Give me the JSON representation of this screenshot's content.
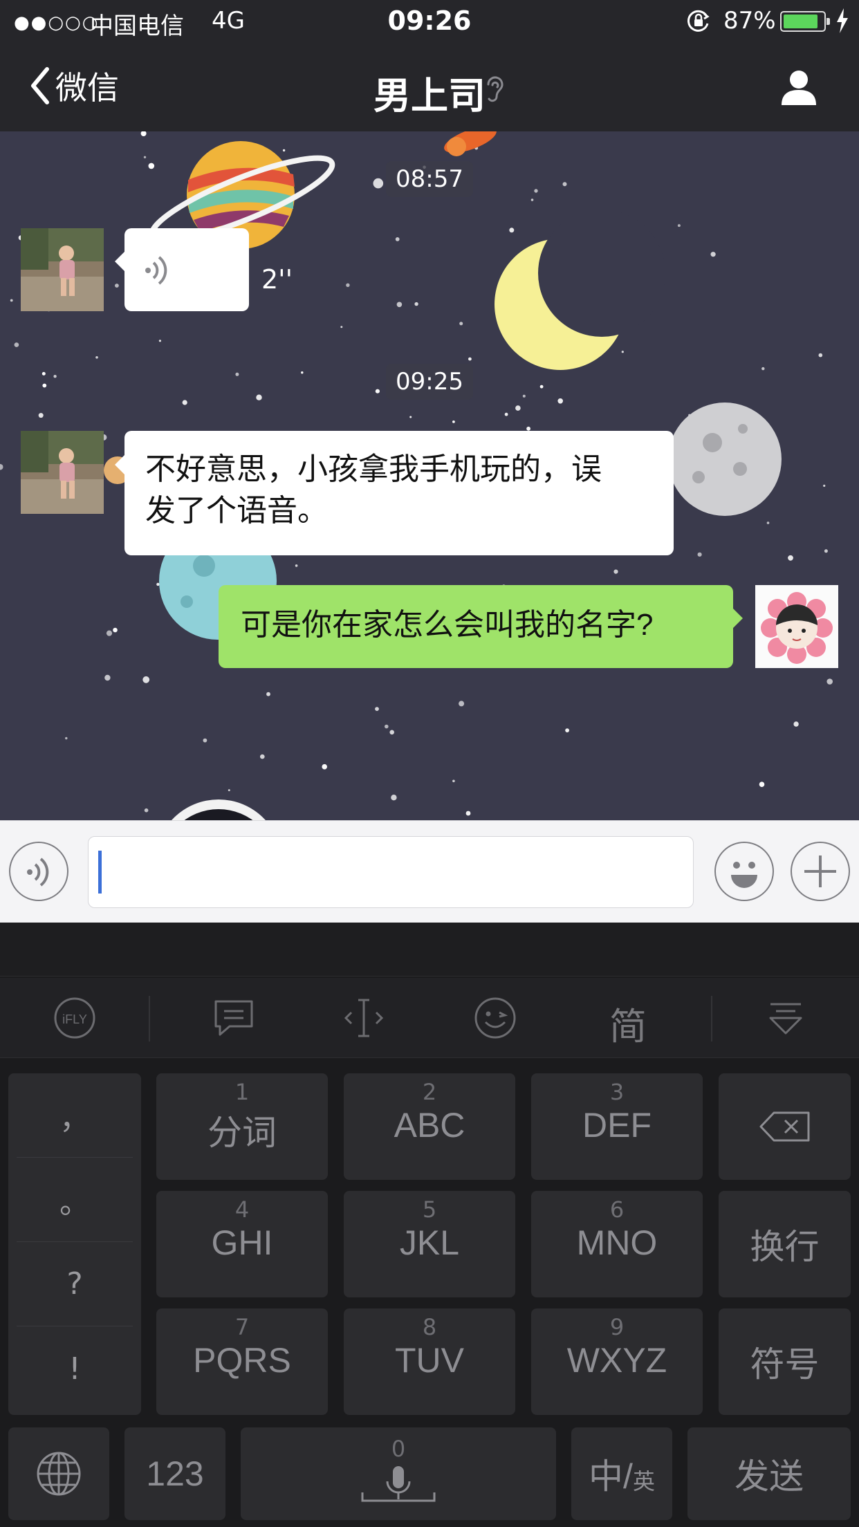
{
  "status_bar": {
    "signal": "●●○○○",
    "carrier": "中国电信",
    "network": "4G",
    "time": "09:26",
    "battery_percent": "87%",
    "battery_level": 0.87,
    "icons": [
      "orientation-lock-icon",
      "battery-icon",
      "charging-bolt-icon"
    ]
  },
  "nav": {
    "back_label": "微信",
    "title": "男上司",
    "icons": [
      "chevron-left-icon",
      "ear-icon",
      "person-icon"
    ]
  },
  "chat": {
    "wallpaper": "space-night-sky",
    "messages": [
      {
        "type": "timestamp",
        "text": "08:57"
      },
      {
        "type": "voice",
        "side": "left",
        "duration": "2''"
      },
      {
        "type": "timestamp",
        "text": "09:25"
      },
      {
        "type": "text",
        "side": "left",
        "lines": [
          "不好意思，小孩拿我手机玩的，误",
          "发了个语音。"
        ]
      },
      {
        "type": "text",
        "side": "right",
        "lines": [
          "可是你在家怎么会叫我的名字?"
        ]
      }
    ]
  },
  "input_bar": {
    "value": "",
    "icons": [
      "voice-input-icon",
      "emoji-icon",
      "plus-icon"
    ]
  },
  "keyboard": {
    "toolbar": {
      "ifly": "iFLY",
      "simplified": "简",
      "icons": [
        "ifly-logo-icon",
        "message-icon",
        "cursor-move-icon",
        "wink-emoji-icon",
        "simplified-chinese-toggle",
        "collapse-keyboard-icon"
      ]
    },
    "punctuation": [
      "，",
      "。",
      "?",
      "!"
    ],
    "grid": [
      {
        "num": "1",
        "label": "分词"
      },
      {
        "num": "2",
        "label": "ABC"
      },
      {
        "num": "3",
        "label": "DEF"
      },
      {
        "num": "4",
        "label": "GHI"
      },
      {
        "num": "5",
        "label": "JKL"
      },
      {
        "num": "6",
        "label": "MNO"
      },
      {
        "num": "7",
        "label": "PQRS"
      },
      {
        "num": "8",
        "label": "TUV"
      },
      {
        "num": "9",
        "label": "WXYZ"
      }
    ],
    "right_keys": {
      "newline": "换行",
      "symbols": "符号"
    },
    "bottom_row": {
      "numbers": "123",
      "space_num": "0",
      "lang_main": "中/",
      "lang_sub": "英",
      "send": "发送"
    },
    "colors": {
      "key": "#2c2c2f",
      "keyboard_bg": "#1b1b1d",
      "key_text": "#8e8e93"
    }
  },
  "colors": {
    "sent_bubble": "#9fe369",
    "received_bubble": "#ffffff",
    "nav_bg": "#26262a",
    "wallpaper": "#3a3a4c",
    "battery": "#5cd65c",
    "caret": "#3b6fd8"
  }
}
